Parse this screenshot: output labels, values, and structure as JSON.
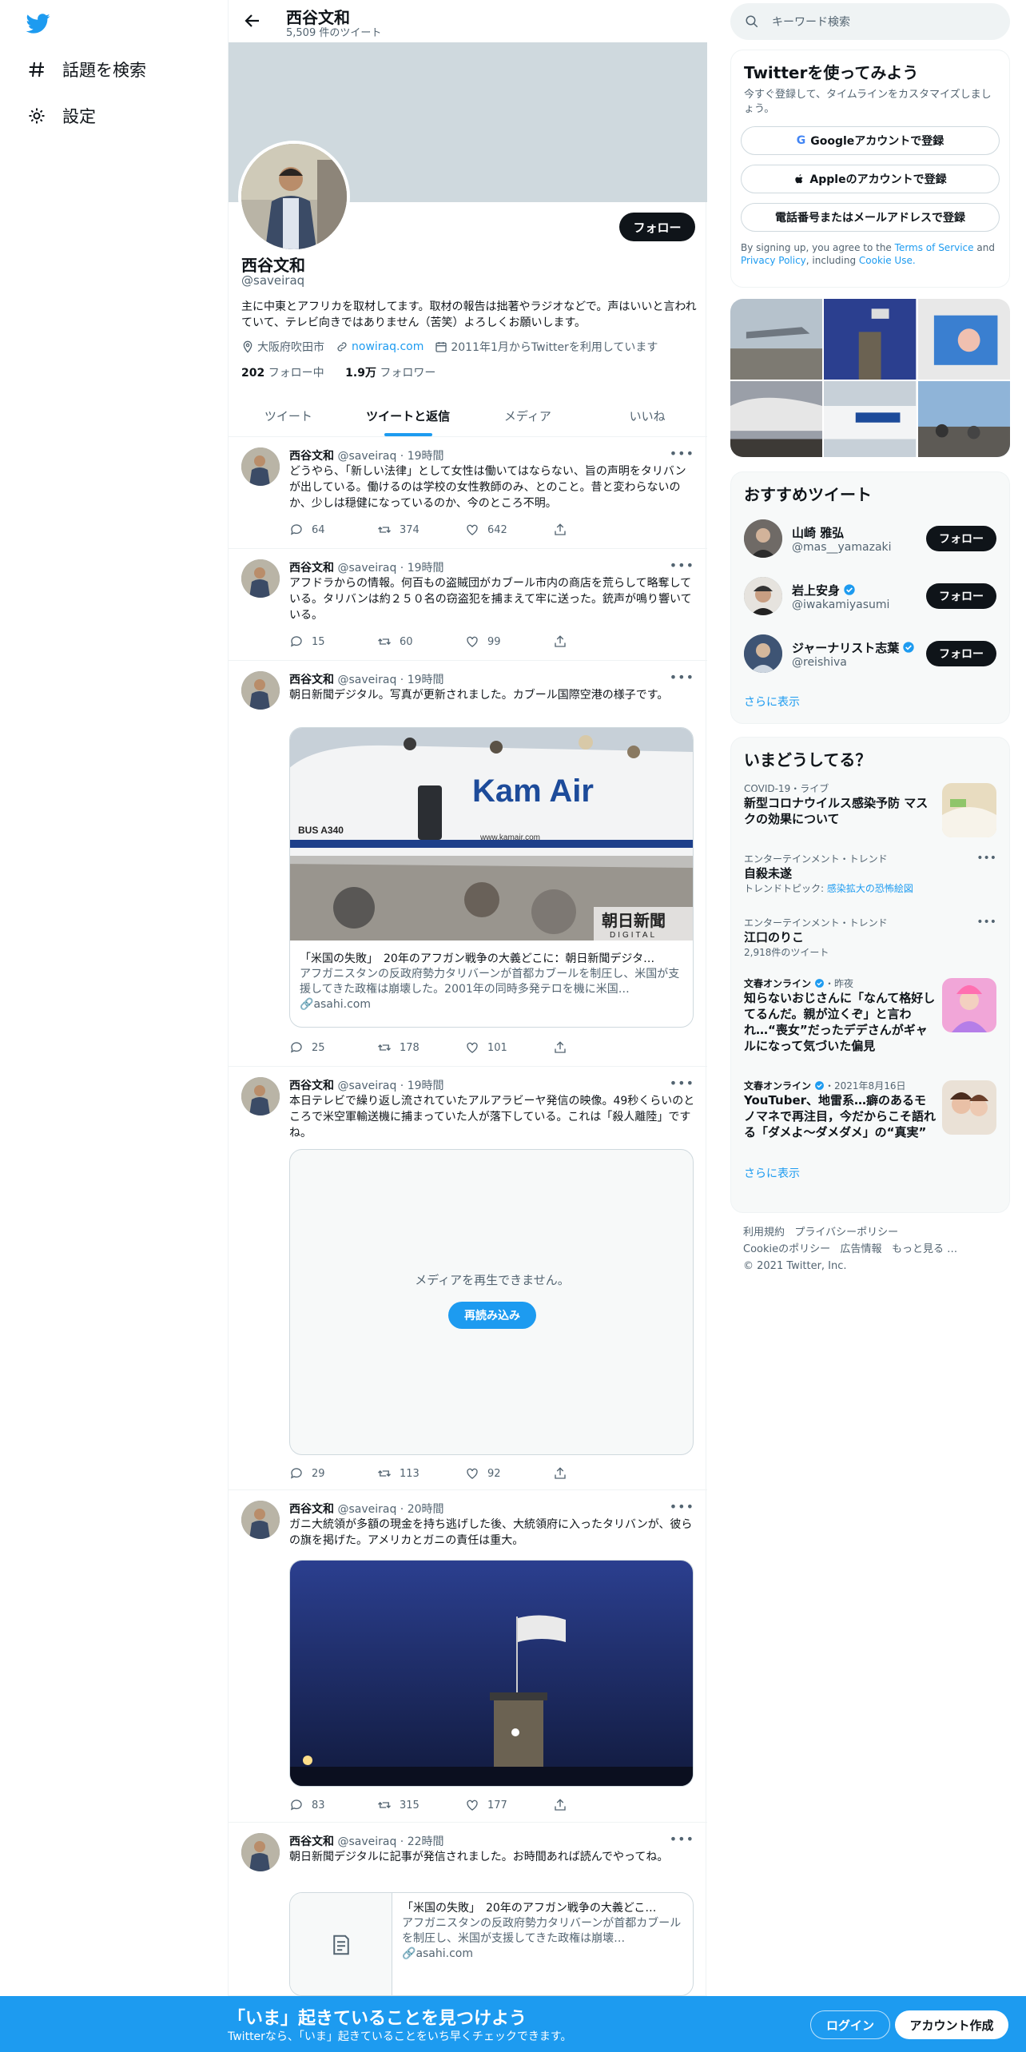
{
  "nav": {
    "explore": "話題を検索",
    "settings": "設定"
  },
  "header": {
    "title": "西谷文和",
    "subtitle": "5,509 件のツイート"
  },
  "profile": {
    "follow": "フォロー",
    "name": "西谷文和",
    "handle": "@saveiraq",
    "bio": "主に中東とアフリカを取材してます。取材の報告は拙著やラジオなどで。声はいいと言われていて、テレビ向きではありません（苦笑）よろしくお願いします。",
    "location": "大阪府吹田市",
    "url": "nowiraq.com",
    "joined": "2011年1月からTwitterを利用しています",
    "following_count": "202",
    "following_label": "フォロー中",
    "followers_count": "1.9万",
    "followers_label": "フォロワー"
  },
  "tabs": [
    "ツイート",
    "ツイートと返信",
    "メディア",
    "いいね"
  ],
  "tweets": [
    {
      "name": "西谷文和",
      "handle": "@saveiraq",
      "time": "19時間",
      "text": "どうやら、「新しい法律」として女性は働いてはならない、旨の声明をタリバンが出している。働けるのは学校の女性教師のみ、とのこと。昔と変わらないのか、少しは穏健になっているのか、今のところ不明。",
      "replies": "64",
      "retweets": "374",
      "likes": "642"
    },
    {
      "name": "西谷文和",
      "handle": "@saveiraq",
      "time": "19時間",
      "text": "アフドラからの情報。何百もの盗賊団がカブール市内の商店を荒らして略奪している。タリバンは約２５０名の窃盗犯を捕まえて牢に送った。銃声が鳴り響いている。",
      "replies": "15",
      "retweets": "60",
      "likes": "99"
    },
    {
      "name": "西谷文和",
      "handle": "@saveiraq",
      "time": "19時間",
      "text": "朝日新聞デジタル。写真が更新されました。カブール国際空港の様子です。",
      "card_title": "「米国の失敗」　20年のアフガン戦争の大義どこに：朝日新聞デジタ…",
      "card_desc": "アフガニスタンの反政府勢力タリバーンが首都カブールを制圧し、米国が支援してきた政権は崩壊した。2001年の同時多発テロを機に米国…",
      "card_domain": "asahi.com",
      "img_brand": "Kam Air",
      "img_plane": "BUS A340",
      "img_site": "www.kamair.com",
      "img_wm1": "朝日新聞",
      "img_wm2": "DIGITAL",
      "replies": "25",
      "retweets": "178",
      "likes": "101"
    },
    {
      "name": "西谷文和",
      "handle": "@saveiraq",
      "time": "19時間",
      "text": "本日テレビで繰り返し流されていたアルアラビーヤ発信の映像。49秒くらいのところで米空軍輸送機に捕まっていた人が落下している。これは「殺人離陸」ですね。",
      "media_error": "メディアを再生できません。",
      "reload": "再読み込み",
      "replies": "29",
      "retweets": "113",
      "likes": "92"
    },
    {
      "name": "西谷文和",
      "handle": "@saveiraq",
      "time": "20時間",
      "text": "ガニ大統領が多額の現金を持ち逃げした後、大統領府に入ったタリバンが、彼らの旗を掲げた。アメリカとガニの責任は重大。",
      "replies": "83",
      "retweets": "315",
      "likes": "177"
    },
    {
      "name": "西谷文和",
      "handle": "@saveiraq",
      "time": "22時間",
      "text": "朝日新聞デジタルに記事が発信されました。お時間あれば読んでやってね。",
      "card_title": "「米国の失敗」　20年のアフガン戦争の大義どこ…",
      "card_desc": "アフガニスタンの反政府勢力タリバーンが首都カブールを制圧し、米国が支援してきた政権は崩壊…",
      "card_domain": "asahi.com"
    }
  ],
  "right": {
    "search_placeholder": "キーワード検索",
    "signup_title": "Twitterを使ってみよう",
    "signup_sub": "今すぐ登録して、タイムラインをカスタマイズしましょう。",
    "google": "Googleアカウントで登録",
    "apple": "Appleのアカウントで登録",
    "phone": "電話番号またはメールアドレスで登録",
    "terms_prefix": "By signing up, you agree to the",
    "terms": "Terms of Service",
    "and": "and",
    "privacy": "Privacy Policy",
    "including": ", including",
    "cookie": "Cookie Use.",
    "rec_title": "おすすめツイート",
    "recs": [
      {
        "name": "山崎 雅弘",
        "handle": "@mas__yamazaki",
        "follow": "フォロー"
      },
      {
        "name": "岩上安身",
        "handle": "@iwakamiyasumi",
        "follow": "フォロー"
      },
      {
        "name": "ジャーナリスト志葉",
        "handle": "@reishiva",
        "follow": "フォロー"
      }
    ],
    "show_more": "さらに表示",
    "trends_title": "いまどうしてる？",
    "trends": [
      {
        "meta": "COVID-19・ライブ",
        "name": "新型コロナウイルス感染予防 マスクの効果について"
      },
      {
        "meta": "エンターテインメント・トレンド",
        "name": "自殺未遂",
        "sub_prefix": "トレンドトピック: ",
        "sub_link": "感染拡大の恐怖絵図"
      },
      {
        "meta": "エンターテインメント・トレンド",
        "name": "江口のりこ",
        "sub": "2,918件のツイート"
      },
      {
        "source": "文春オンライン",
        "time": "・昨夜",
        "name": "知らないおじさんに「なんて格好してるんだ。親が泣くぞ」と言われ…“喪女”だったデデさんがギャルになって気づいた偏見"
      },
      {
        "source": "文春オンライン",
        "time": "・2021年8月16日",
        "name": "YouTuber、地雷系…癖のあるモノマネで再注目，今だからこそ語れる「ダメよ～ダメダメ」の“真実”"
      }
    ],
    "footer": [
      "利用規約",
      "プライバシーポリシー",
      "Cookieのポリシー",
      "広告情報",
      "もっと見る …",
      "© 2021 Twitter, Inc."
    ]
  },
  "bottom": {
    "title": "「いま」起きていることを見つけよう",
    "sub": "Twitterなら、「いま」起きていることをいち早くチェックできます。",
    "login": "ログイン",
    "signup": "アカウント作成"
  }
}
